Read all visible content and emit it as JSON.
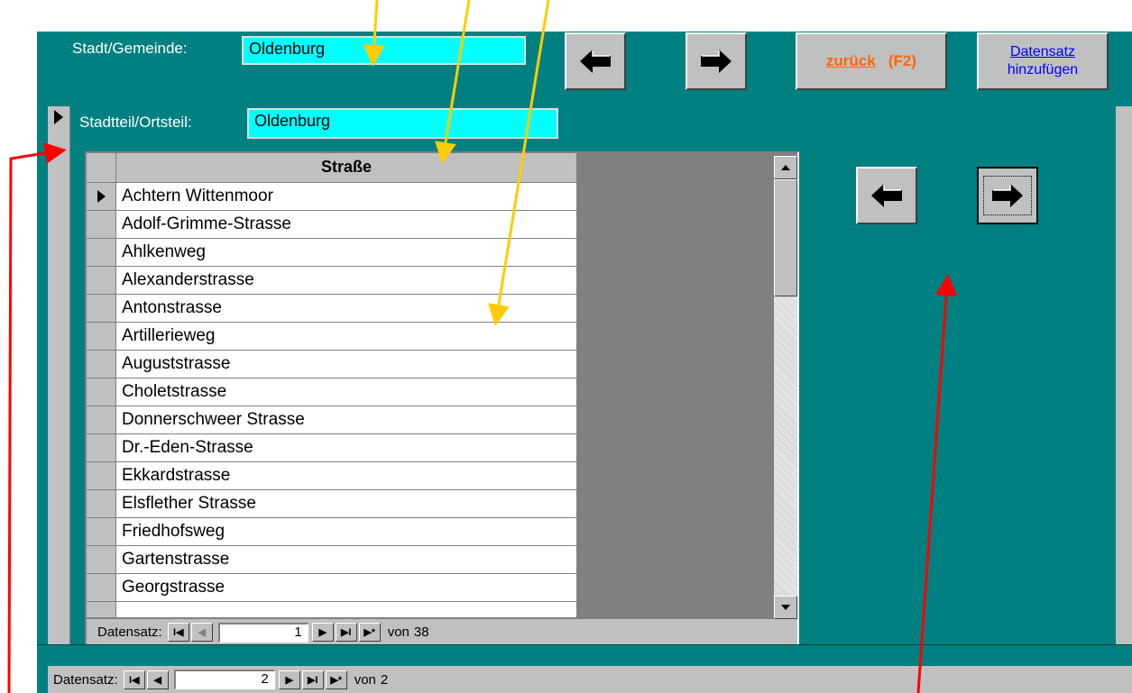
{
  "form": {
    "stadt_label": "Stadt/Gemeinde:",
    "stadt_value": "Oldenburg",
    "back_label": "zurück",
    "back_key": "(F2)",
    "add_record_label_1": "Datensatz",
    "add_record_label_2": "hinzufügen",
    "ortsteil_label": "Stadtteil/Ortsteil:",
    "ortsteil_value": "Oldenburg"
  },
  "subform": {
    "column_header": "Straße",
    "rows": [
      "Achtern Wittenmoor",
      "Adolf-Grimme-Strasse",
      "Ahlkenweg",
      "Alexanderstrasse",
      "Antonstrasse",
      "Artillerieweg",
      "Auguststrasse",
      "Choletstrasse",
      "Donnerschweer Strasse",
      "Dr.-Eden-Strasse",
      "Ekkardstrasse",
      "Elsflether Strasse",
      "Friedhofsweg",
      "Gartenstrasse",
      "Georgstrasse"
    ],
    "nav": {
      "label": "Datensatz:",
      "current": "1",
      "of_label": "von",
      "total": "38"
    }
  },
  "main_nav": {
    "label": "Datensatz:",
    "current": "2",
    "of_label": "von",
    "total": "2"
  },
  "colors": {
    "background": "#008080",
    "field": "#00ffff",
    "back_text": "#ff6600",
    "link_text": "#0000ff",
    "annotation_yellow": "#ffcc00",
    "annotation_red": "#ff0000"
  }
}
